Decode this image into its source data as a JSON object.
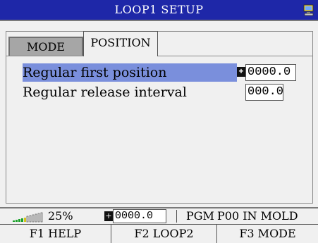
{
  "window": {
    "title": "LOOP1 SETUP",
    "title_bar_color": "#1e27a8",
    "status_icon": "computer-icon"
  },
  "tabs": [
    {
      "label": "MODE",
      "active": false
    },
    {
      "label": "POSITION",
      "active": true
    }
  ],
  "settings": [
    {
      "label": "Regular first position",
      "value": "0000.0",
      "selected": true,
      "selection_color": "#7a8fdc"
    },
    {
      "label": "Regular release interval",
      "value": "000.0",
      "selected": false
    }
  ],
  "status_bar": {
    "signal_icon": "signal-strength-icon",
    "signal_percent": "25%",
    "value": "0000.0",
    "program": "PGM",
    "state": "P00 IN MOLD"
  },
  "function_keys": [
    {
      "label": "F1 HELP"
    },
    {
      "label": "F2 LOOP2"
    },
    {
      "label": "F3 MODE"
    }
  ]
}
